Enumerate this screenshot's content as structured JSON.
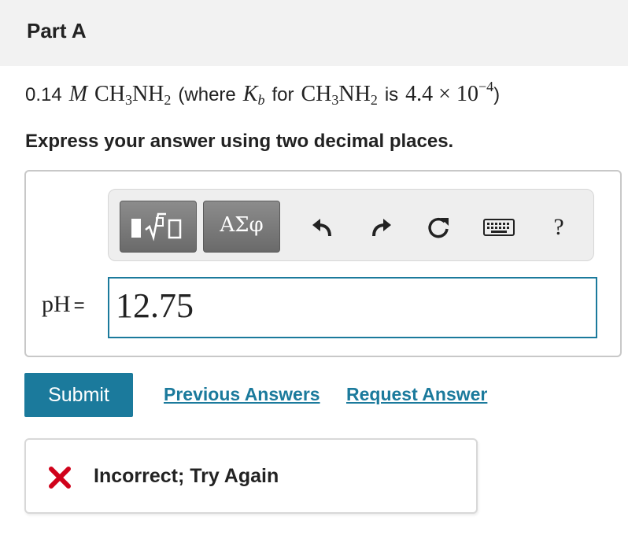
{
  "header": {
    "title": "Part A"
  },
  "question": {
    "concentration": "0.14",
    "molar_symbol": "M",
    "compound": "CH",
    "sub1": "3",
    "compound_b": "NH",
    "sub2": "2",
    "where_text": "(where",
    "kb_symbol": "K",
    "kb_sub": "b",
    "for_text": "for",
    "is_text": "is",
    "kb_value": "4.4",
    "times": "×",
    "base": "10",
    "exponent": "−4",
    "close_paren": ")"
  },
  "instructions": "Express your answer using two decimal places.",
  "toolbar": {
    "templates_icon": "radical-template-icon",
    "symbols_label": "ΑΣφ",
    "undo_icon": "undo-icon",
    "redo_icon": "redo-icon",
    "reset_icon": "reset-icon",
    "keyboard_icon": "keyboard-icon",
    "help_label": "?",
    "button_color": "#7a7a7a"
  },
  "answer": {
    "label": "pH",
    "equals": "=",
    "value": "12.75"
  },
  "actions": {
    "submit_label": "Submit",
    "previous_answers_label": "Previous Answers",
    "request_answer_label": "Request Answer",
    "accent_color": "#1b7a9c"
  },
  "feedback": {
    "icon": "x-icon",
    "text": "Incorrect; Try Again",
    "icon_color": "#d0021b"
  }
}
